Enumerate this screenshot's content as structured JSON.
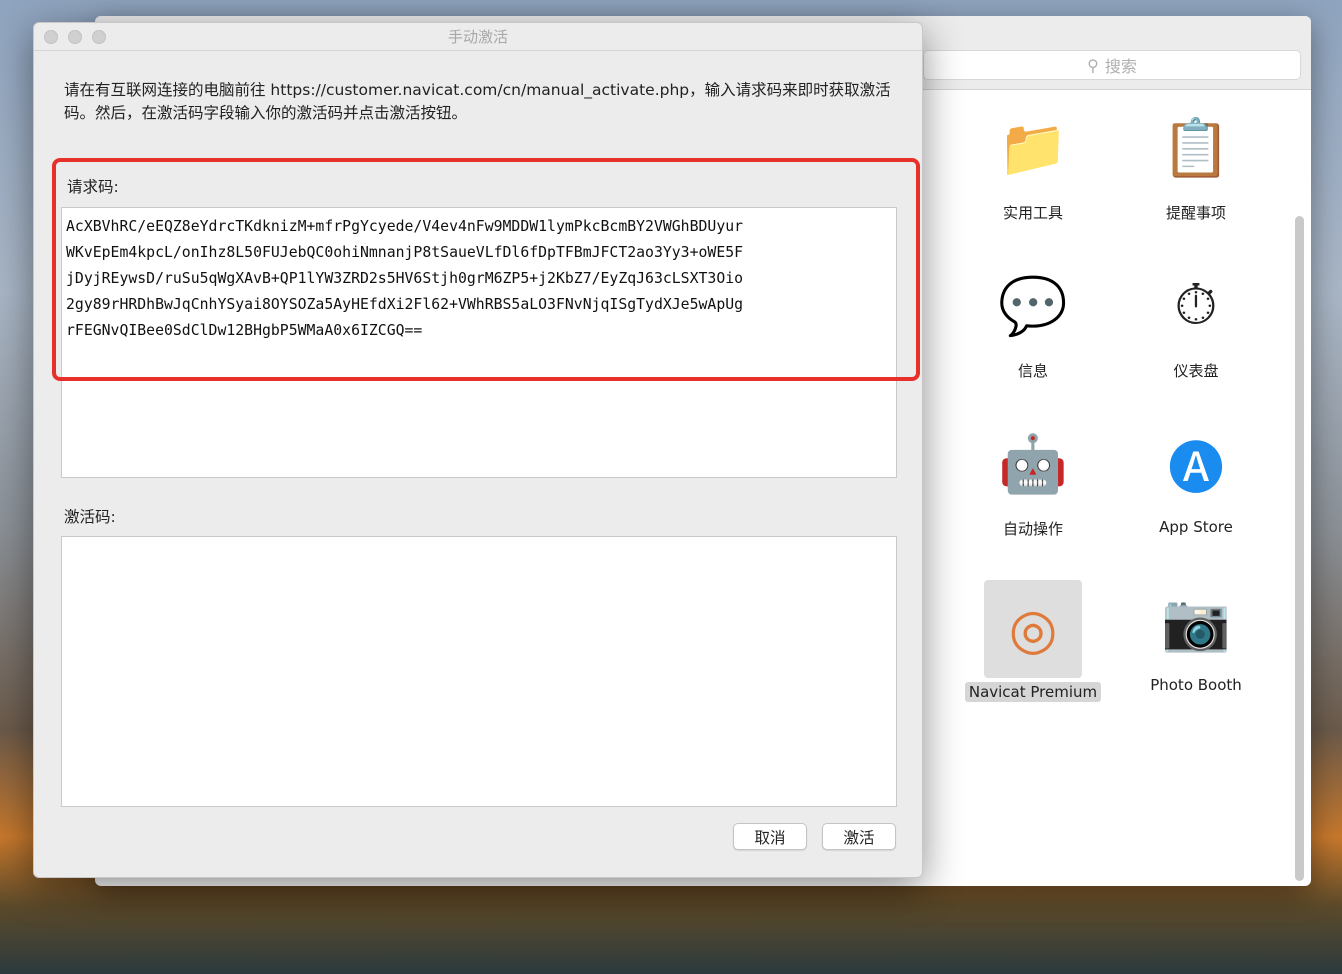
{
  "dialog": {
    "title": "手动激活",
    "intro": "请在有互联网连接的电脑前往 https://customer.navicat.com/cn/manual_activate.php，输入请求码来即时获取激活码。然后，在激活码字段输入你的激活码并点击激活按钮。",
    "request_label": "请求码:",
    "request_code": "AcXBVhRC/eEQZ8eYdrcTKdknizM+mfrPgYcyede/V4ev4nFw9MDDW1lymPkcBcmBY2VWGhBDUyur\nWKvEpEm4kpcL/onIhz8L50FUJebQC0ohiNmnanjP8tSaueVLfDl6fDpTFBmJFCT2ao3Yy3+oWE5F\njDyjREywsD/ruSu5qWgXAvB+QP1lYW3ZRD2s5HV6Stjh0grM6ZP5+j2KbZ7/EyZqJ63cLSXT3Oio\n2gy89rHRDhBwJqCnhYSyai8OYSOZa5AyHEfdXi2Fl62+VWhRBS5aLO3FNvNjqISgTydXJe5wApUg\nrFEGNvQIBee0SdClDw12BHgbP5WMaA0x6IZCGQ==",
    "activation_label": "激活码:",
    "activation_value": "",
    "cancel": "取消",
    "activate": "激活",
    "highlight_color": "#e8302a"
  },
  "finder": {
    "search_placeholder": "搜索",
    "apps": [
      {
        "label": "实用工具",
        "icon": "utilities-folder-icon"
      },
      {
        "label": "提醒事项",
        "icon": "reminders-icon"
      },
      {
        "label": "信息",
        "icon": "messages-icon"
      },
      {
        "label": "仪表盘",
        "icon": "dashboard-icon"
      },
      {
        "label": "自动操作",
        "icon": "automator-icon"
      },
      {
        "label": "App Store",
        "icon": "app-store-icon"
      },
      {
        "label": "Navicat Premium",
        "icon": "navicat-icon",
        "selected": true
      },
      {
        "label": "Photo Booth",
        "icon": "photo-booth-icon"
      }
    ]
  }
}
